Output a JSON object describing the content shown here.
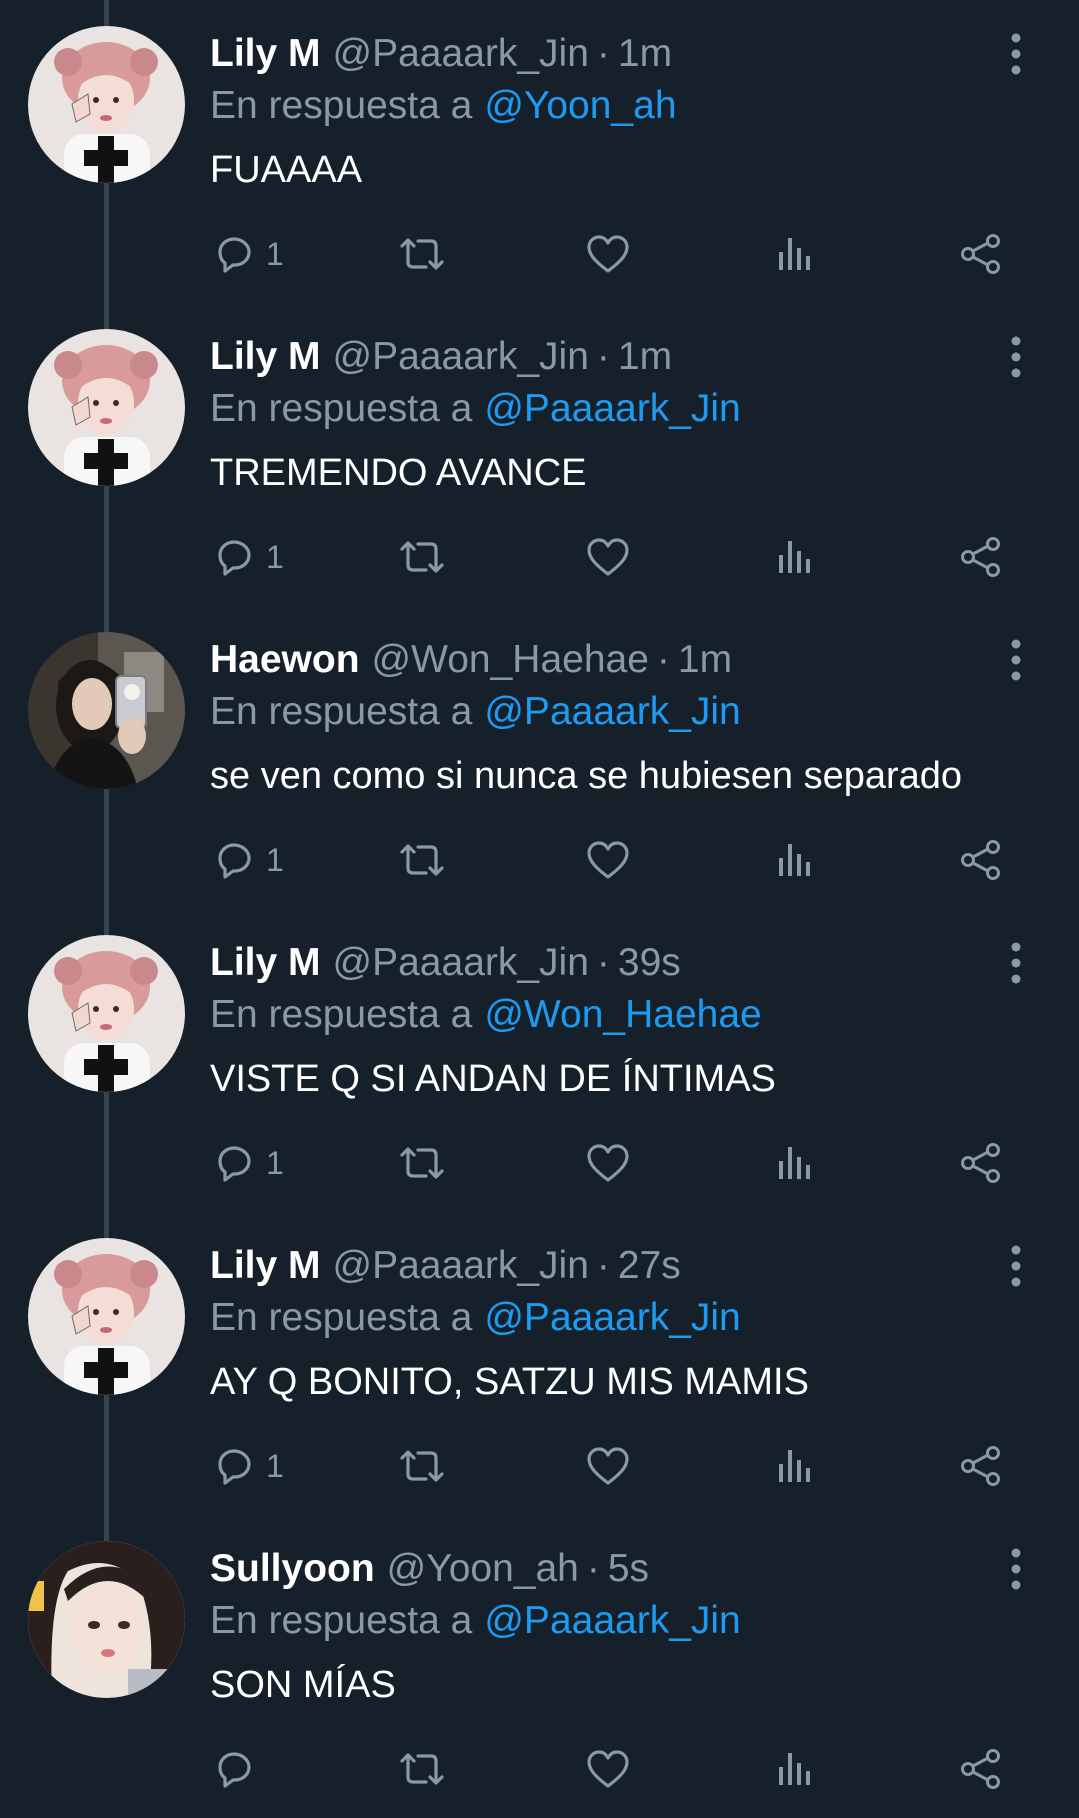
{
  "labels": {
    "reply_prefix": "En respuesta a",
    "dot": "·"
  },
  "colors": {
    "background": "#15202b",
    "text": "#ffffff",
    "muted": "#8b98a5",
    "link": "#1d9bf0",
    "thread_line": "#38444d"
  },
  "tweets": [
    {
      "name": "Lily M",
      "handle": "@Paaaark_Jin",
      "time": "1m",
      "reply_to": "@Yoon_ah",
      "text": "FUAAAA",
      "reply_count": "1",
      "avatar": "lily-avatar"
    },
    {
      "name": "Lily M",
      "handle": "@Paaaark_Jin",
      "time": "1m",
      "reply_to": "@Paaaark_Jin",
      "text": "TREMENDO AVANCE",
      "reply_count": "1",
      "avatar": "lily-avatar"
    },
    {
      "name": "Haewon",
      "handle": "@Won_Haehae",
      "time": "1m",
      "reply_to": "@Paaaark_Jin",
      "text": "se ven como si nunca se hubiesen separado",
      "reply_count": "1",
      "avatar": "haewon-avatar"
    },
    {
      "name": "Lily M",
      "handle": "@Paaaark_Jin",
      "time": "39s",
      "reply_to": "@Won_Haehae",
      "text": "VISTE Q SI ANDAN DE ÍNTIMAS",
      "reply_count": "1",
      "avatar": "lily-avatar"
    },
    {
      "name": "Lily M",
      "handle": "@Paaaark_Jin",
      "time": "27s",
      "reply_to": "@Paaaark_Jin",
      "text": "AY Q BONITO, SATZU MIS MAMIS",
      "reply_count": "1",
      "avatar": "lily-avatar"
    },
    {
      "name": "Sullyoon",
      "handle": "@Yoon_ah",
      "time": "5s",
      "reply_to": "@Paaaark_Jin",
      "text": "SON MÍAS",
      "reply_count": "",
      "avatar": "sullyoon-avatar"
    }
  ]
}
